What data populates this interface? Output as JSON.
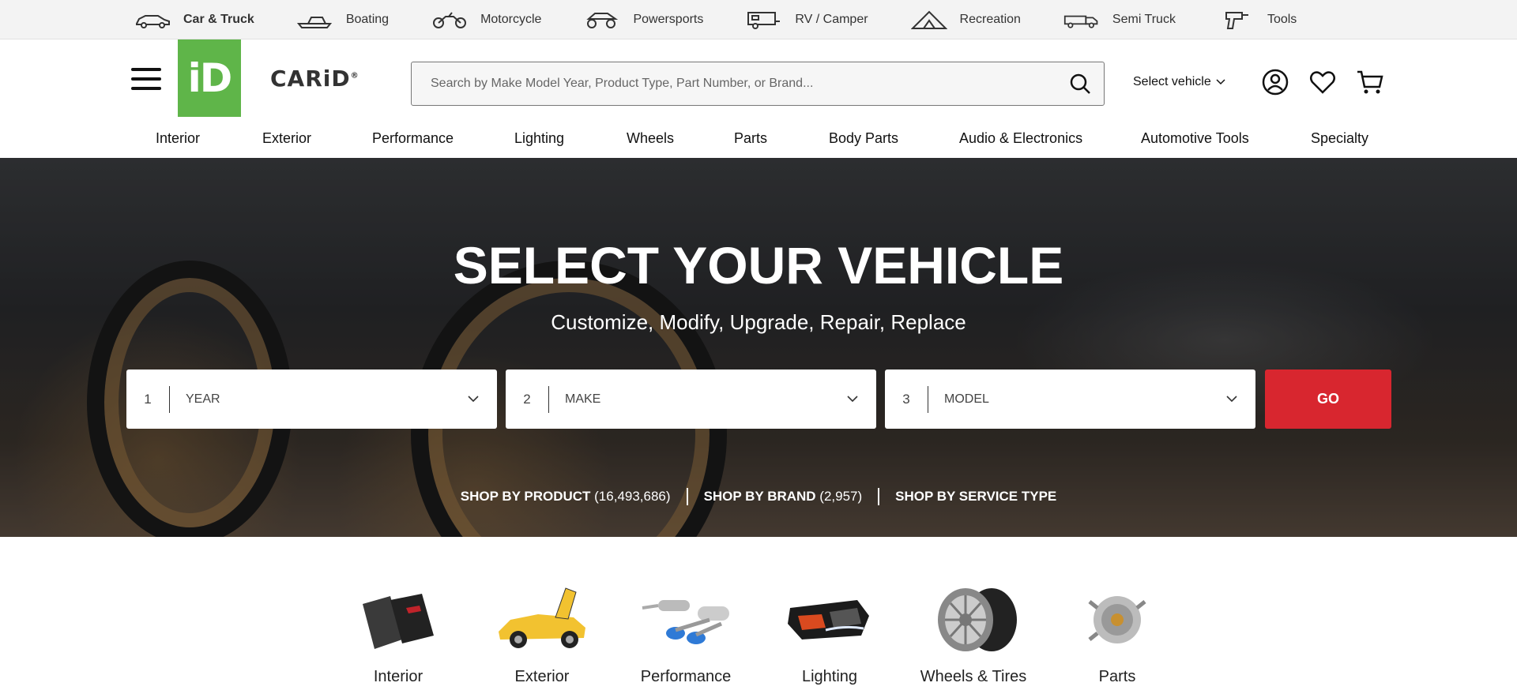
{
  "top_nav": [
    {
      "label": "Car & Truck",
      "icon": "car-icon",
      "active": true
    },
    {
      "label": "Boating",
      "icon": "boat-icon"
    },
    {
      "label": "Motorcycle",
      "icon": "motorcycle-icon"
    },
    {
      "label": "Powersports",
      "icon": "atv-icon"
    },
    {
      "label": "RV / Camper",
      "icon": "rv-icon"
    },
    {
      "label": "Recreation",
      "icon": "tent-icon"
    },
    {
      "label": "Semi Truck",
      "icon": "semi-truck-icon"
    },
    {
      "label": "Tools",
      "icon": "drill-icon"
    }
  ],
  "header": {
    "logo_mark": "iD",
    "logo_text": "CARiD",
    "logo_reg": "®",
    "search_placeholder": "Search by Make Model Year, Product Type, Part Number, or Brand...",
    "select_vehicle": "Select vehicle"
  },
  "categories_nav": [
    "Interior",
    "Exterior",
    "Performance",
    "Lighting",
    "Wheels",
    "Parts",
    "Body Parts",
    "Audio & Electronics",
    "Automotive Tools",
    "Specialty"
  ],
  "hero": {
    "title": "SELECT YOUR VEHICLE",
    "subtitle": "Customize, Modify, Upgrade, Repair, Replace",
    "selectors": [
      {
        "num": "1",
        "label": "YEAR"
      },
      {
        "num": "2",
        "label": "MAKE"
      },
      {
        "num": "3",
        "label": "MODEL"
      }
    ],
    "go_label": "GO",
    "shop_by": [
      {
        "label": "SHOP BY PRODUCT",
        "count": " (16,493,686)"
      },
      {
        "label": "SHOP BY BRAND",
        "count": " (2,957)"
      },
      {
        "label": "SHOP BY SERVICE TYPE",
        "count": ""
      }
    ]
  },
  "category_tiles": [
    {
      "label": "Interior"
    },
    {
      "label": "Exterior"
    },
    {
      "label": "Performance"
    },
    {
      "label": "Lighting"
    },
    {
      "label": "Wheels & Tires"
    },
    {
      "label": "Parts"
    }
  ],
  "colors": {
    "brand_green": "#5fb549",
    "go_red": "#d8262f"
  }
}
